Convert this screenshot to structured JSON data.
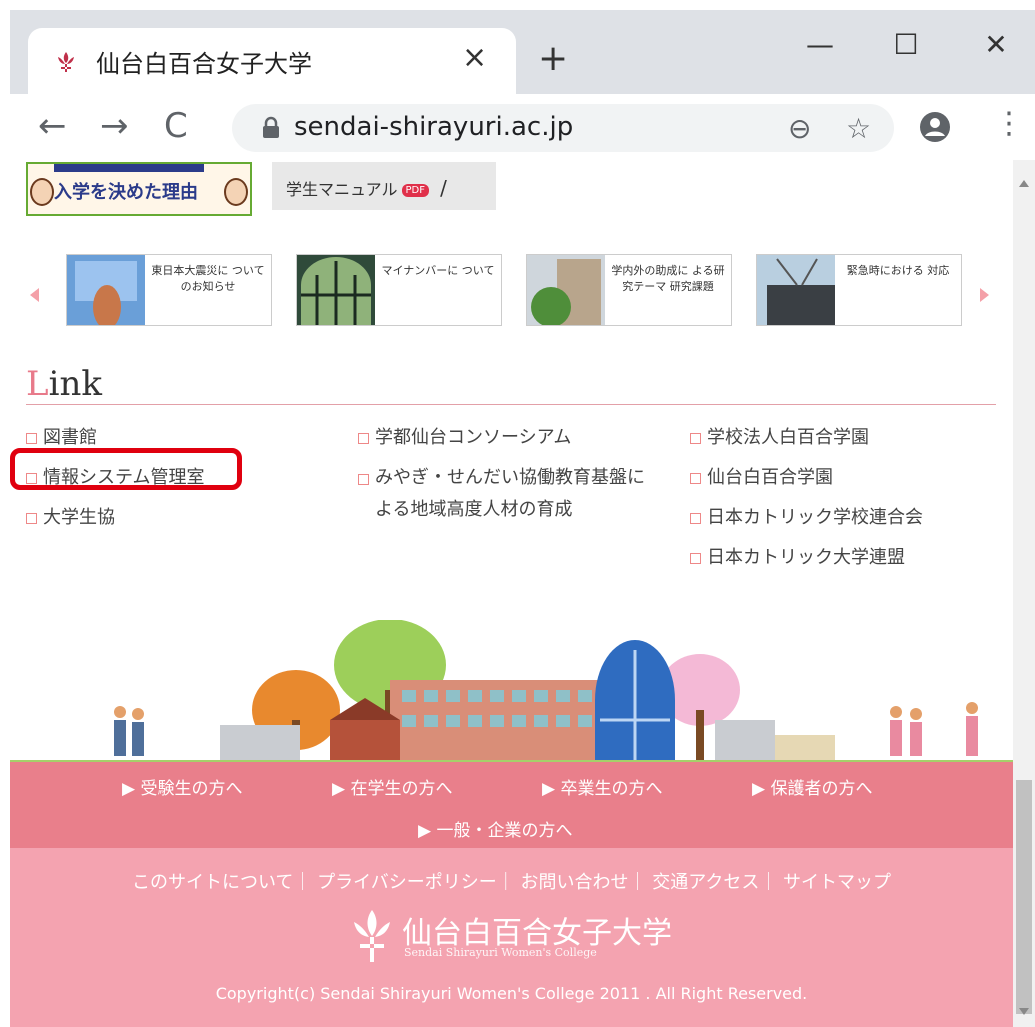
{
  "browser": {
    "tab_title": "仙台白百合女子大学",
    "tab_close": "×",
    "new_tab": "+",
    "url": "sendai-shirayuri.ac.jp",
    "window_minimize": "—",
    "window_maximize": "☐",
    "window_close": "✕"
  },
  "banners": {
    "reason_text": "入学を決めた理由",
    "manual_text": "学生マニュアル",
    "manual_badge": "PDF"
  },
  "carousel": {
    "cards": [
      {
        "text": "東日本大震災に ついてのお知らせ"
      },
      {
        "text": "マイナンバーに ついて"
      },
      {
        "text": "学内外の助成に よる研究テーマ 研究課題"
      },
      {
        "text": "緊急時における 対応"
      }
    ]
  },
  "links_section": {
    "heading_first": "L",
    "heading_rest": "ink",
    "col1": [
      "図書館",
      "情報システム管理室",
      "大学生協"
    ],
    "col2": [
      "学都仙台コンソーシアム",
      "みやぎ・せんだい協働教育基盤による地域高度人材の育成"
    ],
    "col3": [
      "学校法人白百合学園",
      "仙台白百合学園",
      "日本カトリック学校連合会",
      "日本カトリック大学連盟"
    ]
  },
  "footer": {
    "nav": [
      "▶ 受験生の方へ",
      "▶ 在学生の方へ",
      "▶ 卒業生の方へ",
      "▶ 保護者の方へ",
      "▶ 一般・企業の方へ"
    ],
    "links_line": "このサイトについて｜ プライバシーポリシー｜ お問い合わせ｜ 交通アクセス｜ サイトマップ",
    "logo_text": "仙台白百合女子大学",
    "logo_sub": "Sendai Shirayuri Women's College",
    "copyright": "Copyright(c) Sendai Shirayuri Women's College 2011 . All Right Reserved."
  },
  "colors": {
    "accent": "#e97f8b",
    "footer_bg": "#f4a3b0",
    "highlight": "#e0000f"
  }
}
